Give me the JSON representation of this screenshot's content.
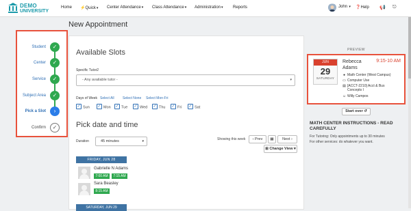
{
  "app": {
    "logo_line1": "DEMO",
    "logo_line2": "UNIVERSITY"
  },
  "nav": {
    "items": [
      "Home",
      "Quick",
      "Center Attendance",
      "Class Attendance",
      "Administration",
      "Reports"
    ],
    "user": "John",
    "help": "Help"
  },
  "page": {
    "title": "New Appointment"
  },
  "wizard": {
    "steps": [
      {
        "label": "Student",
        "state": "done"
      },
      {
        "label": "Center",
        "state": "done"
      },
      {
        "label": "Service",
        "state": "done"
      },
      {
        "label": "Subject Area",
        "state": "done"
      },
      {
        "label": "Pick a Slot",
        "state": "active"
      },
      {
        "label": "Confirm",
        "state": "todo"
      }
    ]
  },
  "slots": {
    "heading": "Available Slots",
    "tutor_label": "Specific Tutor2",
    "tutor_value": "- Any available tutor -",
    "days_label": "Days of Week",
    "select_all": "Select All",
    "select_none": "Select None",
    "select_mon_fri": "Select Mon-Fri",
    "days": [
      "Sun",
      "Mon",
      "Tue",
      "Wed",
      "Thu",
      "Fri",
      "Sat"
    ]
  },
  "pick": {
    "heading": "Pick date and time",
    "duration_label": "Duration",
    "duration_value": "45 minutes",
    "showing_label": "Showing this week",
    "prev": "Prev",
    "next": "Next",
    "change_view": "Change View",
    "day1": "FRIDAY, JUN 28",
    "day2": "SATURDAY, JUN 29",
    "people": [
      {
        "name": "Gabrielle N Adams",
        "times": [
          "7:00 AM",
          "7:15 AM"
        ]
      },
      {
        "name": "Sara Beasley",
        "times": [
          "8:15 AM"
        ]
      }
    ]
  },
  "preview": {
    "label": "PREVIEW",
    "month": "JUN",
    "day": "29",
    "weekday": "SATURDAY",
    "name_line1": "Rebecca",
    "name_line2": "Adams",
    "time": "9:15-10 AM",
    "center": "Math Center (West Campus)",
    "service": "Computer Use",
    "course_line1": "[ACCT-2210] Acct & Bus",
    "course_line2": "Concepts I",
    "staff": "Willy Campos"
  },
  "start_over": "Start over",
  "instructions": {
    "title": "MATH CENTER INSTRUCTIONS - READ CAREFULLY",
    "line1": "For Tutoring: Only appointments up to 30 minutes",
    "line2": "For other services: do whatever you want."
  },
  "colors": {
    "accent": "#1b9aaa",
    "highlight": "#e8513b",
    "done": "#2fa84f",
    "active": "#2b7de9",
    "day_header": "#3f73a3"
  }
}
